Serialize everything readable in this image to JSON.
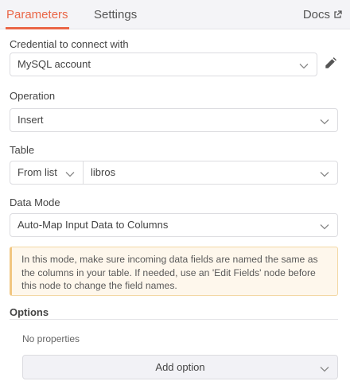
{
  "tabs": {
    "parameters": "Parameters",
    "settings": "Settings",
    "docs": "Docs"
  },
  "credential": {
    "label": "Credential to connect with",
    "value": "MySQL account"
  },
  "operation": {
    "label": "Operation",
    "value": "Insert"
  },
  "table": {
    "label": "Table",
    "mode": "From list",
    "value": "libros"
  },
  "data_mode": {
    "label": "Data Mode",
    "value": "Auto-Map Input Data to Columns"
  },
  "notice": {
    "text": "In this mode, make sure incoming data fields are named the same as the columns in your table. If needed, use an 'Edit Fields' node before this node to change the field names."
  },
  "options": {
    "title": "Options",
    "empty_text": "No properties",
    "add_label": "Add option"
  },
  "icons": {
    "docs": "external-link-icon",
    "edit": "pencil-icon",
    "dropdown": "chevron-down-icon"
  },
  "colors": {
    "accent": "#ea6647",
    "notice_bg": "#fef7ec",
    "notice_border": "#f1c680"
  }
}
